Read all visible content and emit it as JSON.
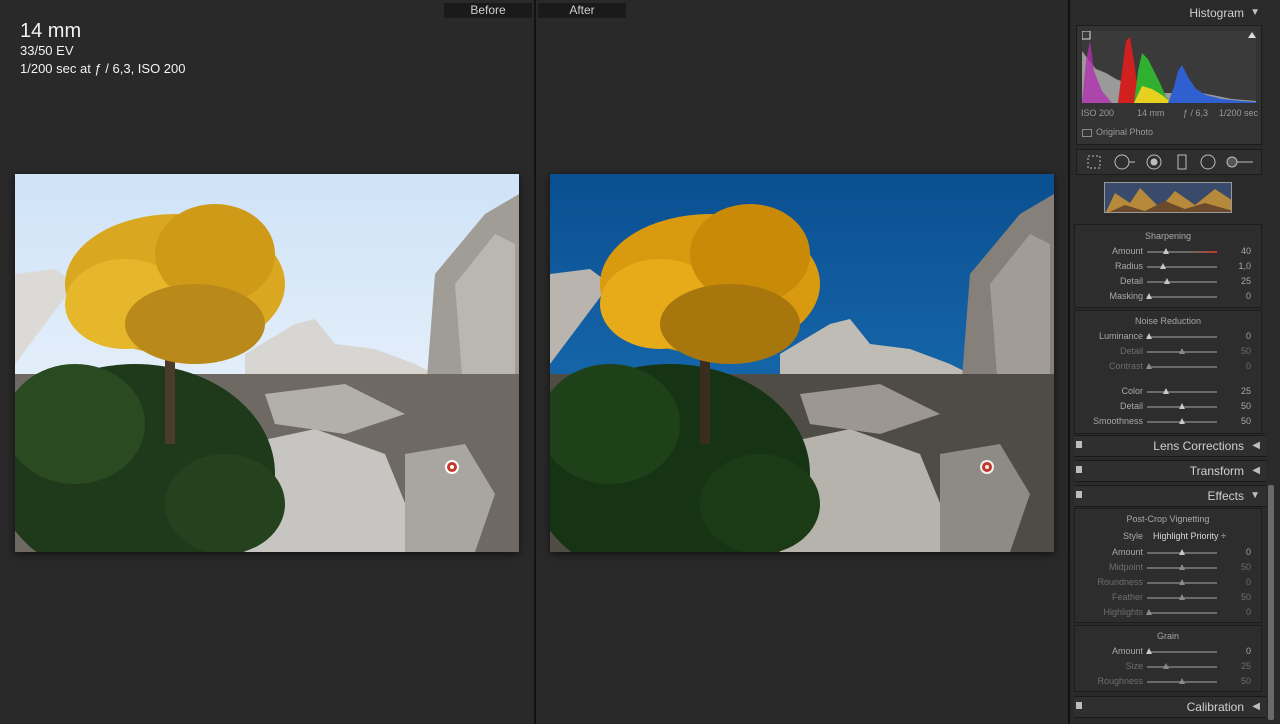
{
  "info": {
    "focal_length": "14 mm",
    "ev": "33/50 EV",
    "exposure": "1/200 sec at ƒ / 6,3, ISO 200"
  },
  "labels": {
    "before": "Before",
    "after": "After"
  },
  "histogram": {
    "title": "Histogram",
    "meta": {
      "iso": "ISO 200",
      "focal": "14 mm",
      "aperture": "ƒ / 6,3",
      "shutter": "1/200 sec"
    },
    "original_photo": "Original Photo"
  },
  "sharpening": {
    "title": "Sharpening",
    "rows": [
      {
        "label": "Amount",
        "value": "40",
        "pos": 0.27
      },
      {
        "label": "Radius",
        "value": "1,0",
        "pos": 0.23
      },
      {
        "label": "Detail",
        "value": "25",
        "pos": 0.28
      },
      {
        "label": "Masking",
        "value": "0",
        "pos": 0.03
      }
    ]
  },
  "noise_reduction": {
    "title": "Noise Reduction",
    "rows": [
      {
        "label": "Luminance",
        "value": "0",
        "pos": 0.03,
        "dim": false
      },
      {
        "label": "Detail",
        "value": "50",
        "pos": 0.5,
        "dim": true
      },
      {
        "label": "Contrast",
        "value": "0",
        "pos": 0.03,
        "dim": true
      },
      {
        "label": "Color",
        "value": "25",
        "pos": 0.27,
        "dim": false
      },
      {
        "label": "Detail",
        "value": "50",
        "pos": 0.5,
        "dim": false
      },
      {
        "label": "Smoothness",
        "value": "50",
        "pos": 0.5,
        "dim": false
      }
    ]
  },
  "panels": {
    "lens_corrections": "Lens Corrections",
    "transform": "Transform",
    "effects": "Effects",
    "calibration": "Calibration"
  },
  "vignetting": {
    "title": "Post-Crop Vignetting",
    "style_label": "Style",
    "style_value": "Highlight Priority ÷",
    "rows": [
      {
        "label": "Amount",
        "value": "0",
        "pos": 0.5,
        "dim": false
      },
      {
        "label": "Midpoint",
        "value": "50",
        "pos": 0.5,
        "dim": true
      },
      {
        "label": "Roundness",
        "value": "0",
        "pos": 0.5,
        "dim": true
      },
      {
        "label": "Feather",
        "value": "50",
        "pos": 0.5,
        "dim": true
      },
      {
        "label": "Highlights",
        "value": "0",
        "pos": 0.03,
        "dim": true
      }
    ]
  },
  "grain": {
    "title": "Grain",
    "rows": [
      {
        "label": "Amount",
        "value": "0",
        "pos": 0.03,
        "dim": false
      },
      {
        "label": "Size",
        "value": "25",
        "pos": 0.27,
        "dim": true
      },
      {
        "label": "Roughness",
        "value": "50",
        "pos": 0.5,
        "dim": true
      }
    ]
  },
  "colors": {
    "accent_red": "#c0392b",
    "sky_before": "#eaf2fa",
    "sky_after": "#0d5a9c"
  }
}
